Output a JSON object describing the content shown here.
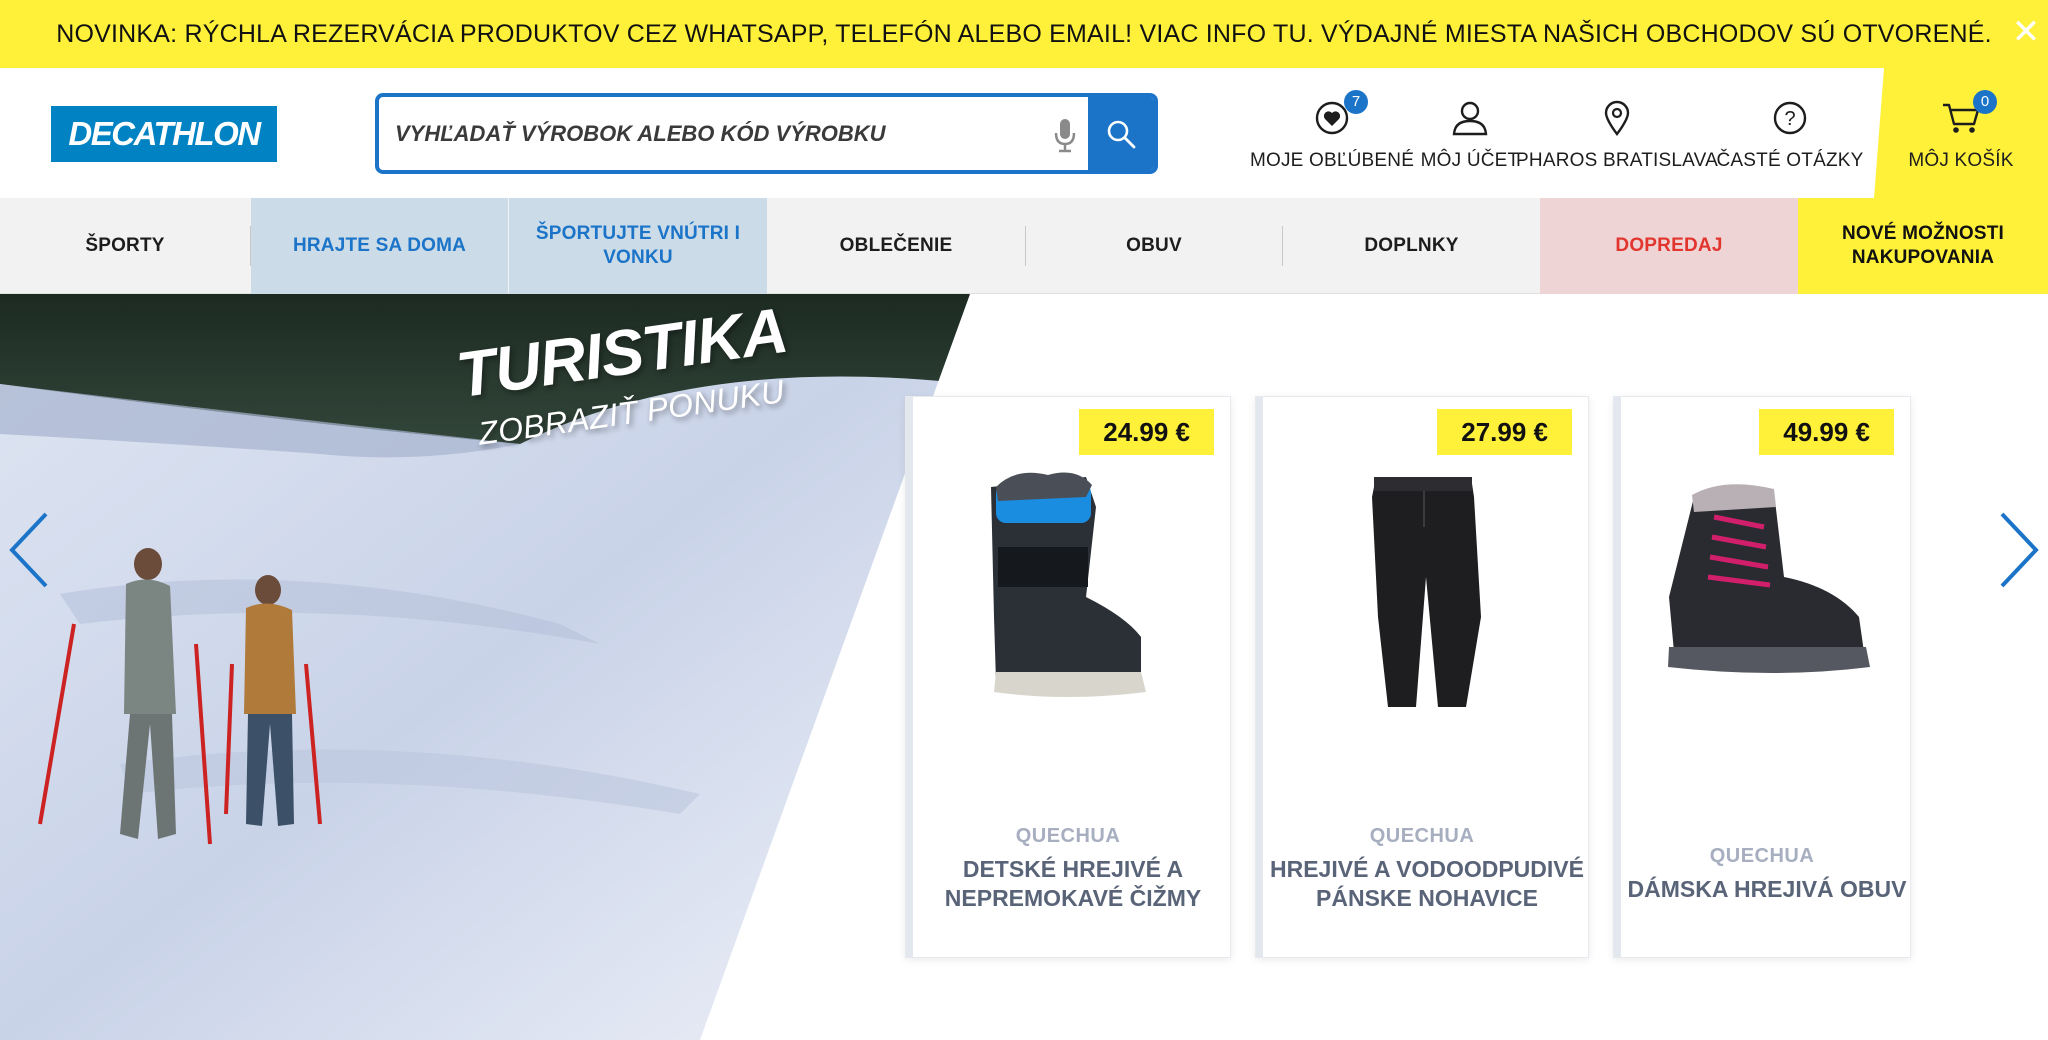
{
  "announcement": {
    "text": "NOVINKA: RÝCHLA REZERVÁCIA PRODUKTOV CEZ WHATSAPP, TELEFÓN ALEBO EMAIL! VIAC INFO TU. VÝDAJNÉ MIESTA NAŠICH OBCHODOV SÚ OTVORENÉ.",
    "close_icon": "close-icon"
  },
  "header": {
    "logo": "DECATHLON",
    "search": {
      "placeholder": "VYHĽADAŤ VÝROBOK ALEBO KÓD VÝROBKU",
      "mic_icon": "microphone-icon",
      "button_icon": "search-icon"
    },
    "favorites": {
      "label": "MOJE OBĽÚBENÉ",
      "count": "7",
      "icon": "heart-icon"
    },
    "account": {
      "label": "MÔJ ÚČET",
      "icon": "user-icon"
    },
    "store": {
      "label": "PHAROS BRATISLAVA",
      "icon": "location-pin-icon"
    },
    "faq": {
      "label": "ČASTÉ OTÁZKY",
      "icon": "question-icon"
    },
    "cart": {
      "label": "MÔJ KOŠÍK",
      "count": "0",
      "icon": "cart-icon"
    }
  },
  "nav": [
    {
      "label": "ŠPORTY"
    },
    {
      "label": "HRAJTE SA DOMA"
    },
    {
      "label": "ŠPORTUJTE VNÚTRI I VONKU"
    },
    {
      "label": "OBLEČENIE"
    },
    {
      "label": "OBUV"
    },
    {
      "label": "DOPLNKY"
    },
    {
      "label": "DOPREDAJ"
    },
    {
      "label": "NOVÉ MOŽNOSTI NAKUPOVANIA"
    }
  ],
  "colors": {
    "brand_blue": "#0082c3",
    "accent_yellow": "#fff13a",
    "sale_red": "#e1352d"
  },
  "hero": {
    "title": "TURISTIKA",
    "subtitle": "ZOBRAZIŤ PONUKU",
    "products": [
      {
        "price": "24.99 €",
        "brand": "QUECHUA",
        "title": "DETSKÉ HREJIVÉ A NEPREMOKAVÉ ČIŽMY"
      },
      {
        "price": "27.99 €",
        "brand": "QUECHUA",
        "title": "HREJIVÉ A VODOODPUDIVÉ PÁNSKE NOHAVICE"
      },
      {
        "price": "49.99 €",
        "brand": "QUECHUA",
        "title": "DÁMSKA HREJIVÁ OBUV"
      }
    ]
  }
}
